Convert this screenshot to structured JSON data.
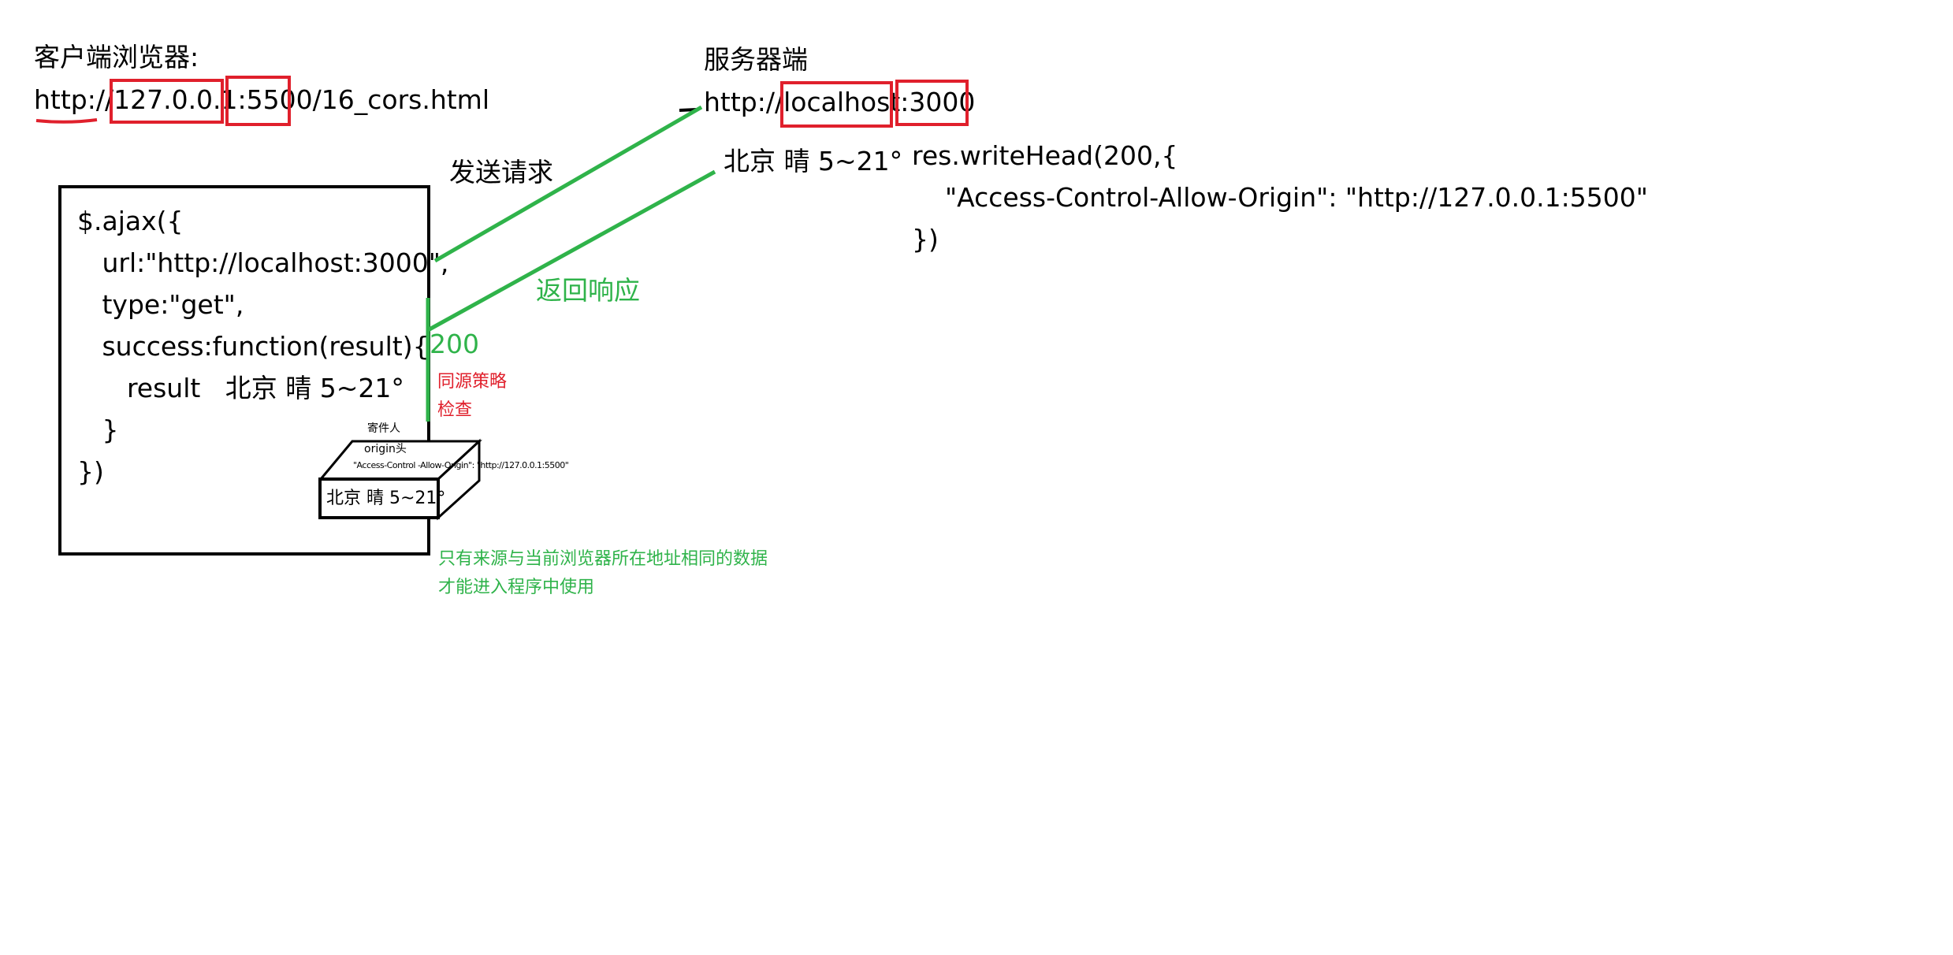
{
  "client": {
    "title": "客户端浏览器:",
    "url": "http://127.0.0.1:5500/16_cors.html"
  },
  "server": {
    "title": "服务器端",
    "url": "http://localhost:3000",
    "response_data": "北京 晴 5~21°",
    "code": [
      "res.writeHead(200,{",
      "    \"Access-Control-Allow-Origin\": \"http://127.0.0.1:5500\"",
      "})"
    ]
  },
  "ajax_code": [
    "$.ajax({",
    "   url:\"http://localhost:3000\",",
    "   type:\"get\",",
    "   success:function(result){",
    "      result   北京 晴 5~21°",
    "   }",
    "})"
  ],
  "arrows": {
    "send_request": "发送请求",
    "return_response": "返回响应"
  },
  "status_code": "200",
  "same_origin_check": [
    "同源策略",
    "检查"
  ],
  "package": {
    "sender": "寄件人",
    "origin_header": "origin头",
    "acao": "\"Access-Control -Allow-Origin\": \"http://127.0.0.1:5500\"",
    "content": "北京 晴 5~21°"
  },
  "note": [
    "只有来源与当前浏览器所在地址相同的数据",
    "才能进入程序中使用"
  ],
  "colors": {
    "red": "#e0202c",
    "green": "#2fb34a",
    "black": "#000000"
  }
}
